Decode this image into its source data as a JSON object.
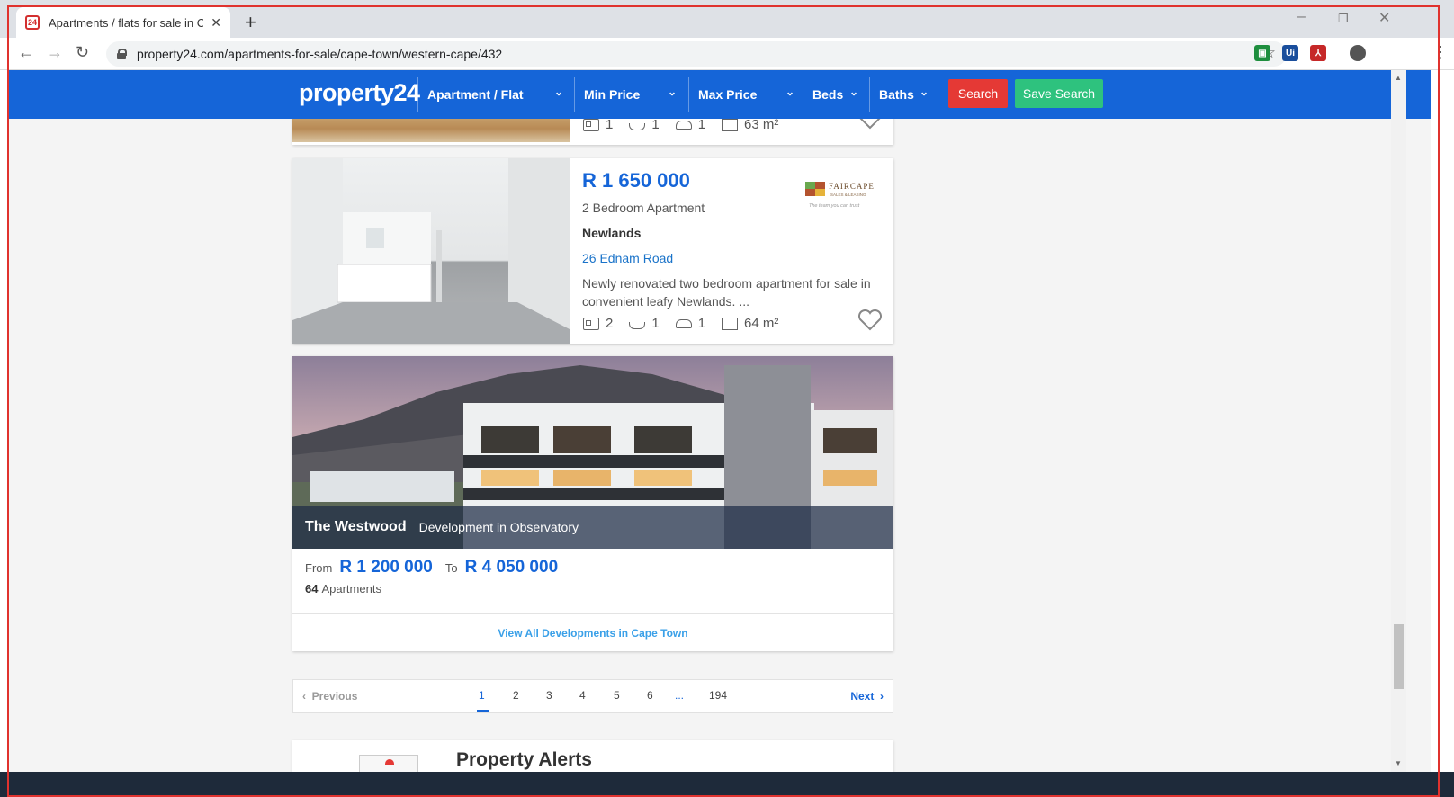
{
  "browser": {
    "tab_title": "Apartments / flats for sale in Cap",
    "tab_favicon_text": "24",
    "url": "property24.com/apartments-for-sale/cape-town/western-cape/432",
    "new_tab_symbol": "+",
    "window_controls": [
      "–",
      "❐",
      "✕"
    ]
  },
  "header": {
    "logo": "property24",
    "filters": [
      {
        "label": "Apartment / Flat"
      },
      {
        "label": "Min Price"
      },
      {
        "label": "Max Price"
      },
      {
        "label": "Beds"
      },
      {
        "label": "Baths"
      }
    ],
    "search_label": "Search",
    "save_search_label": "Save Search",
    "colors": {
      "bar": "#1565d8",
      "search": "#e53935",
      "save": "#2ec27e"
    }
  },
  "listings": [
    {
      "beds": "1",
      "baths": "1",
      "parking": "1",
      "size": "63 m²"
    },
    {
      "price": "R 1 650 000",
      "type": "2 Bedroom Apartment",
      "suburb": "Newlands",
      "street": "26 Ednam Road",
      "description": "Newly renovated two bedroom apartment for sale in convenient leafy Newlands. ...",
      "beds": "2",
      "baths": "1",
      "parking": "1",
      "size": "64 m²",
      "agency": {
        "name": "FAIRCAPE",
        "sub": "SALES & LEASING",
        "tagline": "The team you can trust"
      }
    }
  ],
  "development": {
    "name": "The Westwood",
    "subtitle": "Development in Observatory",
    "from_label": "From",
    "from_price": "R 1 200 000",
    "to_label": "To",
    "to_price": "R 4 050 000",
    "count": "64",
    "count_label": "Apartments",
    "view_all": "View All Developments in Cape Town"
  },
  "pagination": {
    "previous": "Previous",
    "next": "Next",
    "pages": [
      "1",
      "2",
      "3",
      "4",
      "5",
      "6",
      "...",
      "194"
    ],
    "current": "1"
  },
  "alerts": {
    "title": "Property Alerts"
  }
}
